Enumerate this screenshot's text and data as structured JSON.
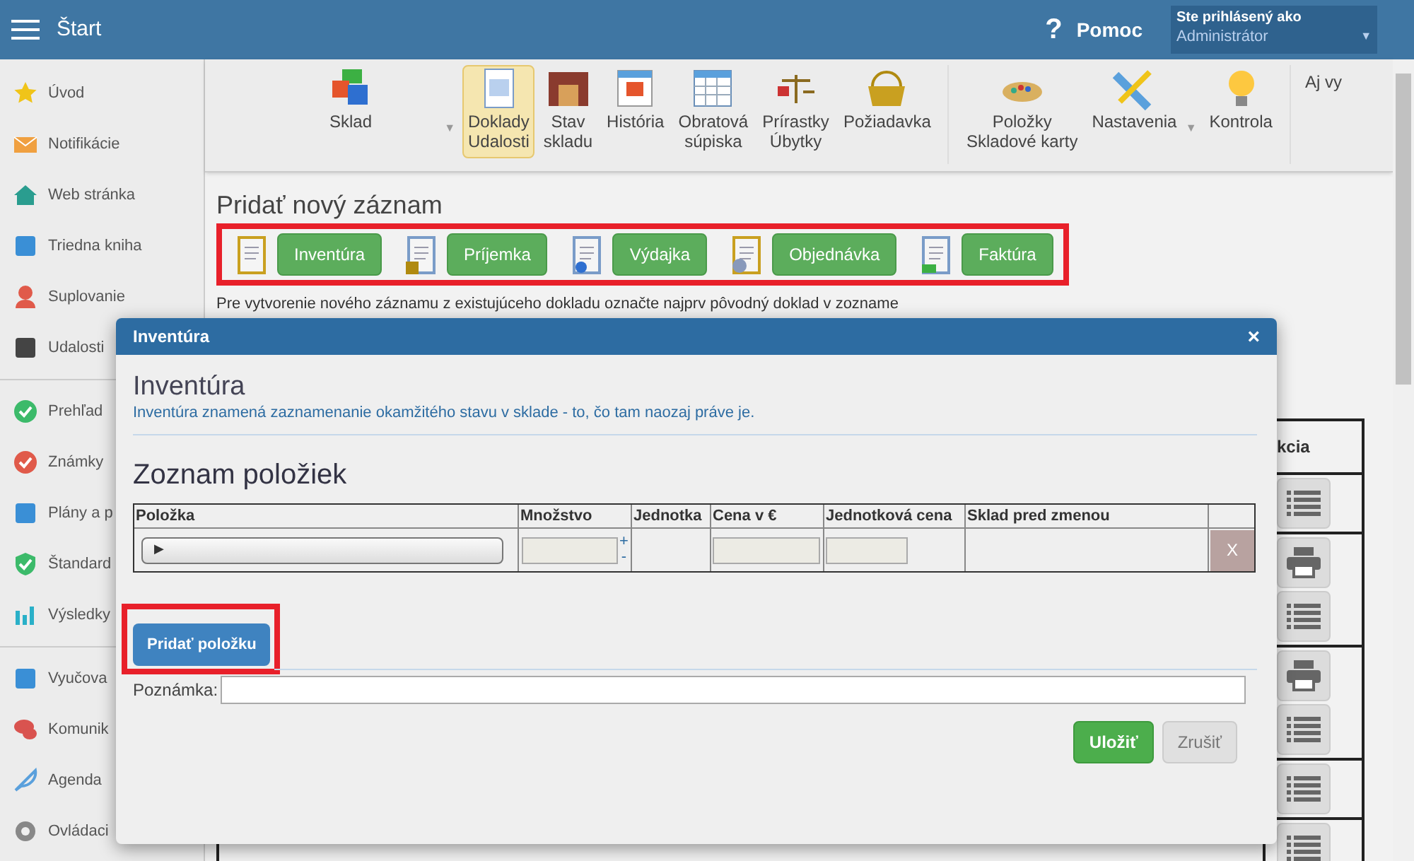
{
  "header": {
    "title": "Štart",
    "help_icon": "?",
    "help": "Pomoc",
    "user_caret": "▼",
    "user_label": "Ste prihlásený ako",
    "user_name": "Administrátor"
  },
  "sidebar": {
    "groups": [
      [
        {
          "label": "Úvod"
        },
        {
          "label": "Notifikácie"
        },
        {
          "label": "Web stránka"
        },
        {
          "label": "Triedna kniha"
        },
        {
          "label": "Suplovanie"
        },
        {
          "label": "Udalosti"
        }
      ],
      [
        {
          "label": "Prehľad"
        },
        {
          "label": "Známky"
        },
        {
          "label": "Plány a p"
        },
        {
          "label": "Štandard"
        },
        {
          "label": "Výsledky"
        }
      ],
      [
        {
          "label": "Vyučova"
        },
        {
          "label": "Komunik"
        },
        {
          "label": "Agenda"
        },
        {
          "label": "Ovládaci"
        }
      ]
    ]
  },
  "toolbar": {
    "groups": [
      [
        {
          "lines": [
            "Sklad"
          ],
          "selected": false,
          "caret": "▼"
        },
        {
          "lines": [
            "Doklady",
            "Udalosti"
          ],
          "selected": true
        },
        {
          "lines": [
            "Stav",
            "skladu"
          ],
          "selected": false
        },
        {
          "lines": [
            "História"
          ],
          "selected": false
        },
        {
          "lines": [
            "Obratová",
            "súpiska"
          ],
          "selected": false
        },
        {
          "lines": [
            "Prírastky",
            "Úbytky"
          ],
          "selected": false
        },
        {
          "lines": [
            "Požiadavka"
          ],
          "selected": false
        }
      ],
      [
        {
          "lines": [
            "Položky",
            "Skladové karty"
          ],
          "selected": false
        },
        {
          "lines": [
            "Nastavenia"
          ],
          "selected": false,
          "caret": "▼"
        },
        {
          "lines": [
            "Kontrola"
          ],
          "selected": false
        }
      ]
    ],
    "extra": "Aj vy"
  },
  "page": {
    "heading": "Pridať nový záznam",
    "add_buttons": [
      "Inventúra",
      "Príjemka",
      "Výdajka",
      "Objednávka",
      "Faktúra"
    ],
    "note": "Pre vytvorenie nového záznamu z existujúceho dokladu označte najprv pôvodný doklad v zozname",
    "table": {
      "last_column": "kcia",
      "rows": [
        {
          "actions": [
            {
              "kind": "list"
            }
          ]
        },
        {
          "actions": [
            {
              "kind": "print"
            },
            {
              "kind": "list"
            }
          ]
        },
        {
          "actions": [
            {
              "kind": "print"
            },
            {
              "kind": "list"
            }
          ]
        },
        {
          "actions": [
            {
              "kind": "list"
            }
          ]
        },
        {
          "actions": [
            {
              "kind": "list"
            }
          ]
        }
      ]
    }
  },
  "modal": {
    "title": "Inventúra",
    "close": "×",
    "heading": "Inventúra",
    "description": "Inventúra znamená zaznamenanie okamžitého stavu v sklade - to, čo tam naozaj práve je.",
    "list_title": "Zoznam položiek",
    "columns": [
      "Položka",
      "Množstvo",
      "Jednotka",
      "Cena v €",
      "Jednotková cena",
      "Sklad pred zmenou"
    ],
    "row": {
      "select": "▶",
      "plus": "+",
      "minus": "-",
      "remove": "X"
    },
    "add_button": "Pridať položku",
    "note_label": "Poznámka:",
    "buttons": [
      {
        "label": "Uložiť",
        "kind": "primary"
      },
      {
        "label": "Zrušiť",
        "kind": "secondary"
      }
    ]
  }
}
